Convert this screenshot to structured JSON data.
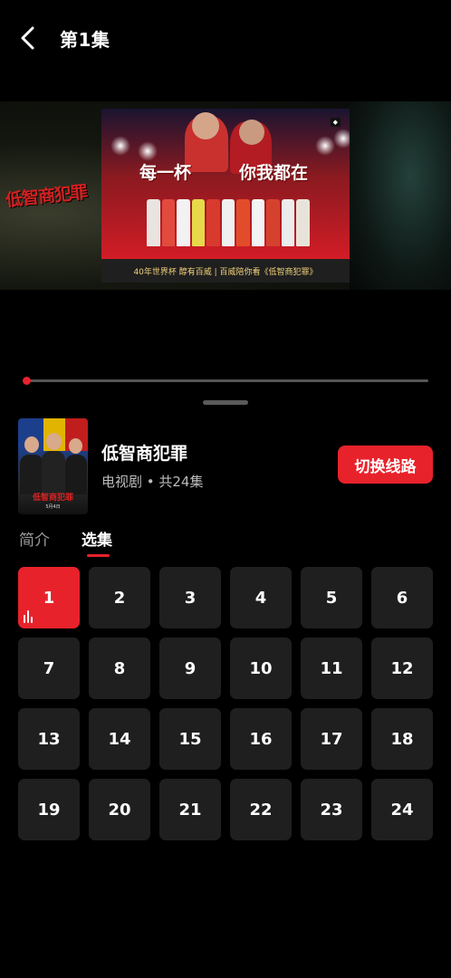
{
  "header": {
    "title": "第1集"
  },
  "player": {
    "show_logo_text": "低智商犯罪",
    "ad": {
      "slogan_left": "每一杯",
      "slogan_right": "你我都在",
      "caption": "40年世界杯 醇有百威 | 百威陪你看《低智商犯罪》"
    },
    "progress": 0.0
  },
  "show": {
    "poster_title": "低智商犯罪",
    "poster_date": "5月4日",
    "name": "低智商犯罪",
    "meta": "电视剧 • 共24集",
    "switch_label": "切换线路"
  },
  "tabs": [
    {
      "label": "简介",
      "active": false
    },
    {
      "label": "选集",
      "active": true
    }
  ],
  "episodes": [
    "1",
    "2",
    "3",
    "4",
    "5",
    "6",
    "7",
    "8",
    "9",
    "10",
    "11",
    "12",
    "13",
    "14",
    "15",
    "16",
    "17",
    "18",
    "19",
    "20",
    "21",
    "22",
    "23",
    "24"
  ],
  "current_episode": "1",
  "colors": {
    "accent": "#e8222b",
    "background": "#000000",
    "tile": "#1f1f1f"
  }
}
